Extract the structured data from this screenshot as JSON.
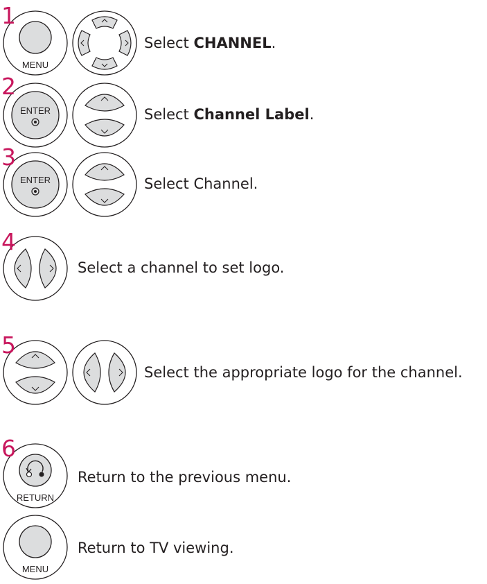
{
  "steps": [
    {
      "number": "1",
      "prefix": "Select ",
      "bold": "CHANNEL",
      "suffix": ".",
      "button_label": "MENU"
    },
    {
      "number": "2",
      "prefix": "Select ",
      "bold": "Channel Label",
      "suffix": ".",
      "button_label": "ENTER"
    },
    {
      "number": "3",
      "prefix": "Select Channel.",
      "bold": "",
      "suffix": "",
      "button_label": "ENTER"
    },
    {
      "number": "4",
      "prefix": "Select a channel to set logo.",
      "bold": "",
      "suffix": ""
    },
    {
      "number": "5",
      "prefix": "Select the appropriate logo for the channel.",
      "bold": "",
      "suffix": ""
    },
    {
      "number": "6",
      "prefix": "Return to the previous menu.",
      "bold": "",
      "suffix": "",
      "button_label": "RETURN"
    },
    {
      "number": "",
      "prefix": "Return to TV viewing.",
      "bold": "",
      "suffix": "",
      "button_label": "MENU"
    }
  ],
  "colors": {
    "step_number": "#c8175d",
    "button_fill": "#dcddde",
    "outline": "#231f20"
  }
}
